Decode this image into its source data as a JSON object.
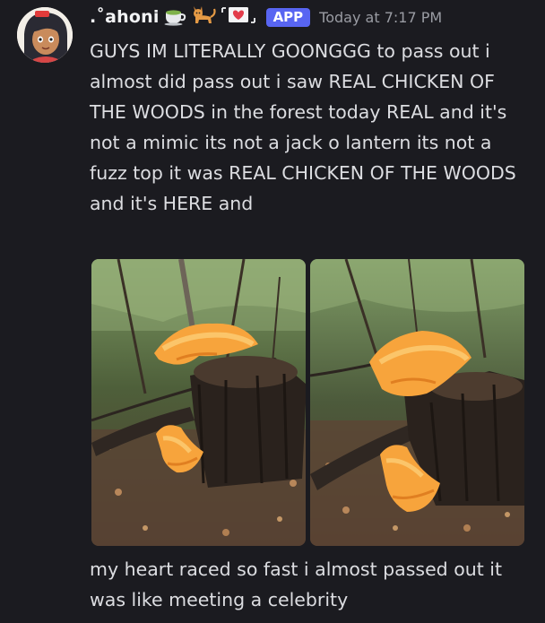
{
  "message": {
    "username": ".˚ahoni",
    "badge": "APP",
    "timestamp": "Today at 7:17 PM",
    "text": "GUYS IM LITERALLY GOONGGG to pass out i almost did pass out i saw REAL CHICKEN OF THE WOODS in the forest today REAL and it's not a mimic its not a jack o lantern its not a fuzz top it was REAL CHICKEN OF THE WOODS and it's HERE and",
    "text_after": "my heart raced so fast i almost passed out it was like meeting a celebrity",
    "username_emojis": [
      "tea-cup-icon",
      "cat-icon",
      "heart-envelope-icon"
    ],
    "attachments": [
      {
        "icon": "mushroom-log-photo-1"
      },
      {
        "icon": "mushroom-log-photo-2"
      }
    ]
  },
  "colors": {
    "background": "#1b1b20",
    "text": "#dcdde1",
    "username": "#f2f3f5",
    "timestamp": "#9a9ca3",
    "app_badge": "#5865f2",
    "mushroom": "#f7a43c"
  }
}
